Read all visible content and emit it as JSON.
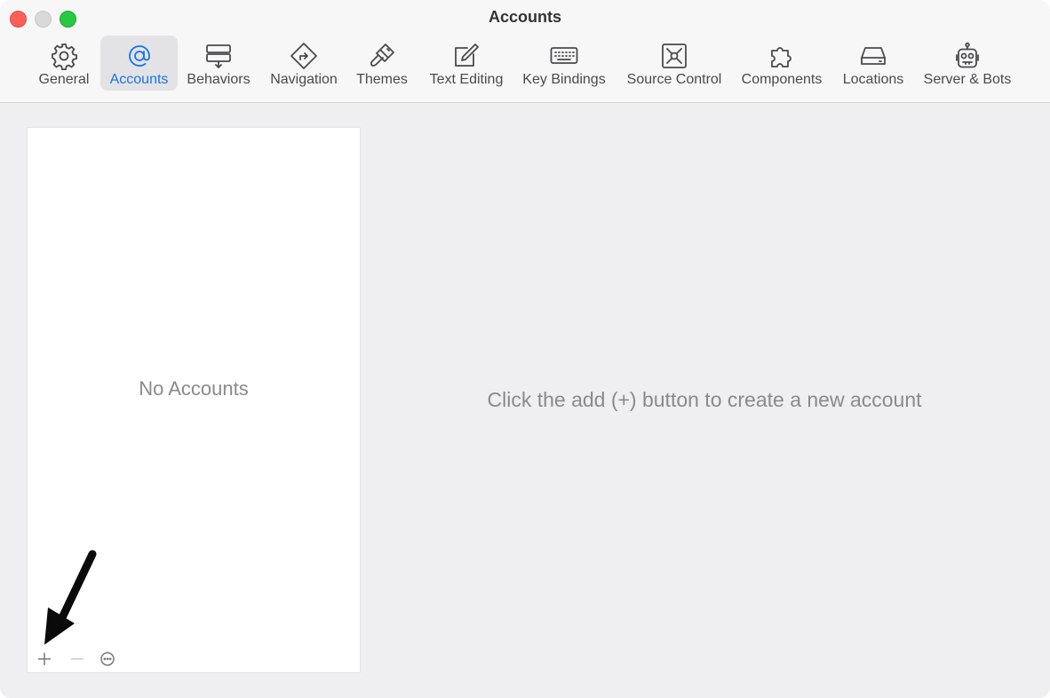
{
  "window": {
    "title": "Accounts"
  },
  "toolbar": {
    "items": [
      {
        "label": "General",
        "icon": "gear-icon"
      },
      {
        "label": "Accounts",
        "icon": "at-sign-icon",
        "selected": true
      },
      {
        "label": "Behaviors",
        "icon": "behaviors-icon"
      },
      {
        "label": "Navigation",
        "icon": "navigation-icon"
      },
      {
        "label": "Themes",
        "icon": "paintbrush-icon"
      },
      {
        "label": "Text Editing",
        "icon": "pencil-square-icon"
      },
      {
        "label": "Key Bindings",
        "icon": "keyboard-icon"
      },
      {
        "label": "Source Control",
        "icon": "source-control-icon"
      },
      {
        "label": "Components",
        "icon": "puzzle-icon"
      },
      {
        "label": "Locations",
        "icon": "drive-icon"
      },
      {
        "label": "Server & Bots",
        "icon": "robot-icon"
      }
    ]
  },
  "accounts_list": {
    "empty_text": "No Accounts",
    "add_label": "+",
    "remove_label": "−"
  },
  "detail": {
    "empty_text": "Click the add (+) button to create a new account"
  },
  "colors": {
    "accent": "#1a74e8",
    "close": "#fe5f57",
    "zoom": "#28c840"
  }
}
